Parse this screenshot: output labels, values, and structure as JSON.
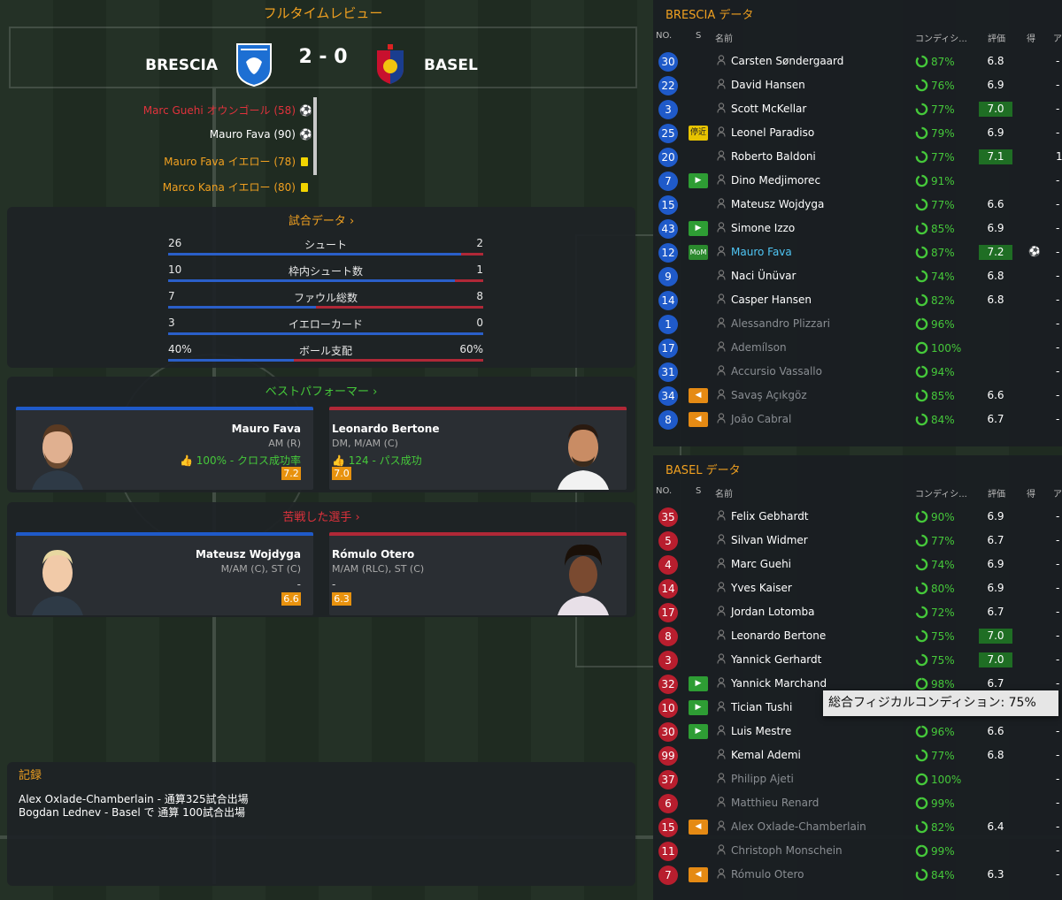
{
  "header": {
    "title": "フルタイムレビュー",
    "home_team": "BRESCIA",
    "away_team": "BASEL",
    "score": "2 - 0"
  },
  "events": [
    {
      "text": "Marc Guehi オウンゴール (58)",
      "type": "own-goal"
    },
    {
      "text": "Mauro Fava (90)",
      "type": "goal"
    },
    {
      "text": "Mauro Fava イエロー (78)",
      "type": "yellow"
    },
    {
      "text": "Marco Kana イエロー (80)",
      "type": "yellow"
    }
  ],
  "match_stats": {
    "title": "試合データ",
    "rows": [
      {
        "home": "26",
        "label": "シュート",
        "away": "2",
        "home_frac": 0.93
      },
      {
        "home": "10",
        "label": "枠内シュート数",
        "away": "1",
        "home_frac": 0.91
      },
      {
        "home": "7",
        "label": "ファウル総数",
        "away": "8",
        "home_frac": 0.47
      },
      {
        "home": "3",
        "label": "イエローカード",
        "away": "0",
        "home_frac": 1.0
      },
      {
        "home": "40%",
        "label": "ボール支配",
        "away": "60%",
        "home_frac": 0.4
      }
    ]
  },
  "best": {
    "title": "ベストパフォーマー",
    "home": {
      "name": "Mauro Fava",
      "pos": "AM (R)",
      "stat": "100% - クロス成功率",
      "rating": "7.2"
    },
    "away": {
      "name": "Leonardo Bertone",
      "pos": "DM, M/AM (C)",
      "stat": "124 - パス成功",
      "rating": "7.0"
    }
  },
  "worst": {
    "title": "苦戦した選手",
    "home": {
      "name": "Mateusz Wojdyga",
      "pos": "M/AM (C), ST (C)",
      "stat": "-",
      "rating": "6.6"
    },
    "away": {
      "name": "Rómulo Otero",
      "pos": "M/AM (RLC), ST (C)",
      "stat": "-",
      "rating": "6.3"
    }
  },
  "records": {
    "title": "記録",
    "lines": [
      "Alex Oxlade-Chamberlain - 通算325試合出場",
      "Bogdan Lednev - Basel で 通算 100試合出場"
    ]
  },
  "columns": {
    "no": "NO.",
    "s": "S",
    "name": "名前",
    "cond": "コンディシ...",
    "rating": "評価",
    "goals": "得",
    "extra": "ア"
  },
  "brescia": {
    "title": "BRESCIA データ",
    "players": [
      {
        "no": "30",
        "badge": "",
        "name": "Carsten Søndergaard",
        "cond": "87%",
        "cond_val": 87,
        "rating": "6.8",
        "hi": false,
        "goal": "",
        "extra": "-",
        "dim": false
      },
      {
        "no": "22",
        "badge": "",
        "name": "David Hansen",
        "cond": "76%",
        "cond_val": 76,
        "rating": "6.9",
        "hi": false,
        "goal": "",
        "extra": "-",
        "dim": false
      },
      {
        "no": "3",
        "badge": "",
        "name": "Scott McKellar",
        "cond": "77%",
        "cond_val": 77,
        "rating": "7.0",
        "hi": true,
        "goal": "",
        "extra": "-",
        "dim": false
      },
      {
        "no": "25",
        "badge": "停近",
        "name": "Leonel Paradiso",
        "cond": "79%",
        "cond_val": 79,
        "rating": "6.9",
        "hi": false,
        "goal": "",
        "extra": "-",
        "dim": false
      },
      {
        "no": "20",
        "badge": "",
        "name": "Roberto Baldoni",
        "cond": "77%",
        "cond_val": 77,
        "rating": "7.1",
        "hi": true,
        "goal": "",
        "extra": "1",
        "dim": false
      },
      {
        "no": "7",
        "badge": "in",
        "name": "Dino Medjimorec",
        "cond": "91%",
        "cond_val": 91,
        "rating": "",
        "hi": false,
        "goal": "",
        "extra": "-",
        "dim": false
      },
      {
        "no": "15",
        "badge": "",
        "name": "Mateusz Wojdyga",
        "cond": "77%",
        "cond_val": 77,
        "rating": "6.6",
        "hi": false,
        "goal": "",
        "extra": "-",
        "dim": false
      },
      {
        "no": "43",
        "badge": "in",
        "name": "Simone Izzo",
        "cond": "85%",
        "cond_val": 85,
        "rating": "6.9",
        "hi": false,
        "goal": "",
        "extra": "-",
        "dim": false
      },
      {
        "no": "12",
        "badge": "MoM",
        "name": "Mauro Fava",
        "cond": "87%",
        "cond_val": 87,
        "rating": "7.2",
        "hi": true,
        "goal": "⚽",
        "extra": "-",
        "dim": false,
        "mom": true
      },
      {
        "no": "9",
        "badge": "",
        "name": "Naci Ünüvar",
        "cond": "74%",
        "cond_val": 74,
        "rating": "6.8",
        "hi": false,
        "goal": "",
        "extra": "-",
        "dim": false
      },
      {
        "no": "14",
        "badge": "",
        "name": "Casper Hansen",
        "cond": "82%",
        "cond_val": 82,
        "rating": "6.8",
        "hi": false,
        "goal": "",
        "extra": "-",
        "dim": false
      },
      {
        "no": "1",
        "badge": "",
        "name": "Alessandro Plizzari",
        "cond": "96%",
        "cond_val": 96,
        "rating": "",
        "hi": false,
        "goal": "",
        "extra": "-",
        "dim": true
      },
      {
        "no": "17",
        "badge": "",
        "name": "Ademílson",
        "cond": "100%",
        "cond_val": 100,
        "rating": "",
        "hi": false,
        "goal": "",
        "extra": "-",
        "dim": true
      },
      {
        "no": "31",
        "badge": "",
        "name": "Accursio Vassallo",
        "cond": "94%",
        "cond_val": 94,
        "rating": "",
        "hi": false,
        "goal": "",
        "extra": "-",
        "dim": true
      },
      {
        "no": "34",
        "badge": "out",
        "name": "Savaş Açıkgöz",
        "cond": "85%",
        "cond_val": 85,
        "rating": "6.6",
        "hi": false,
        "goal": "",
        "extra": "-",
        "dim": true
      },
      {
        "no": "8",
        "badge": "out",
        "name": "João Cabral",
        "cond": "84%",
        "cond_val": 84,
        "rating": "6.7",
        "hi": false,
        "goal": "",
        "extra": "-",
        "dim": true
      }
    ]
  },
  "basel": {
    "title": "BASEL データ",
    "players": [
      {
        "no": "35",
        "badge": "",
        "name": "Felix Gebhardt",
        "cond": "90%",
        "cond_val": 90,
        "rating": "6.9",
        "hi": false,
        "extra": "-",
        "dim": false
      },
      {
        "no": "5",
        "badge": "",
        "name": "Silvan Widmer",
        "cond": "77%",
        "cond_val": 77,
        "rating": "6.7",
        "hi": false,
        "extra": "-",
        "dim": false
      },
      {
        "no": "4",
        "badge": "",
        "name": "Marc Guehi",
        "cond": "74%",
        "cond_val": 74,
        "rating": "6.9",
        "hi": false,
        "extra": "-",
        "dim": false
      },
      {
        "no": "14",
        "badge": "",
        "name": "Yves Kaiser",
        "cond": "80%",
        "cond_val": 80,
        "rating": "6.9",
        "hi": false,
        "extra": "-",
        "dim": false
      },
      {
        "no": "17",
        "badge": "",
        "name": "Jordan Lotomba",
        "cond": "72%",
        "cond_val": 72,
        "rating": "6.7",
        "hi": false,
        "extra": "-",
        "dim": false
      },
      {
        "no": "8",
        "badge": "",
        "name": "Leonardo Bertone",
        "cond": "75%",
        "cond_val": 75,
        "rating": "7.0",
        "hi": true,
        "extra": "-",
        "dim": false
      },
      {
        "no": "3",
        "badge": "",
        "name": "Yannick Gerhardt",
        "cond": "75%",
        "cond_val": 75,
        "rating": "7.0",
        "hi": true,
        "extra": "-",
        "dim": false
      },
      {
        "no": "32",
        "badge": "in",
        "name": "Yannick Marchand",
        "cond": "98%",
        "cond_val": 98,
        "rating": "6.7",
        "hi": false,
        "extra": "-",
        "dim": false
      },
      {
        "no": "10",
        "badge": "in",
        "name": "Tician Tushi",
        "cond": "",
        "cond_val": 0,
        "rating": "",
        "hi": false,
        "extra": "",
        "dim": false
      },
      {
        "no": "30",
        "badge": "in",
        "name": "Luis Mestre",
        "cond": "96%",
        "cond_val": 96,
        "rating": "6.6",
        "hi": false,
        "extra": "-",
        "dim": false
      },
      {
        "no": "99",
        "badge": "",
        "name": "Kemal Ademi",
        "cond": "77%",
        "cond_val": 77,
        "rating": "6.8",
        "hi": false,
        "extra": "-",
        "dim": false
      },
      {
        "no": "37",
        "badge": "",
        "name": "Philipp Ajeti",
        "cond": "100%",
        "cond_val": 100,
        "rating": "",
        "hi": false,
        "extra": "-",
        "dim": true
      },
      {
        "no": "6",
        "badge": "",
        "name": "Matthieu Renard",
        "cond": "99%",
        "cond_val": 99,
        "rating": "",
        "hi": false,
        "extra": "-",
        "dim": true
      },
      {
        "no": "15",
        "badge": "out",
        "name": "Alex Oxlade-Chamberlain",
        "cond": "82%",
        "cond_val": 82,
        "rating": "6.4",
        "hi": false,
        "extra": "-",
        "dim": true
      },
      {
        "no": "11",
        "badge": "",
        "name": "Christoph Monschein",
        "cond": "99%",
        "cond_val": 99,
        "rating": "",
        "hi": false,
        "extra": "-",
        "dim": true
      },
      {
        "no": "7",
        "badge": "out",
        "name": "Rómulo Otero",
        "cond": "84%",
        "cond_val": 84,
        "rating": "6.3",
        "hi": false,
        "extra": "-",
        "dim": true
      }
    ]
  },
  "tooltip": "総合フィジカルコンディション: 75%",
  "colors": {
    "accent": "#f0a020",
    "home": "#1f5ac9",
    "away": "#b81e2e",
    "good": "#45c83a",
    "negative": "#e0323c"
  }
}
